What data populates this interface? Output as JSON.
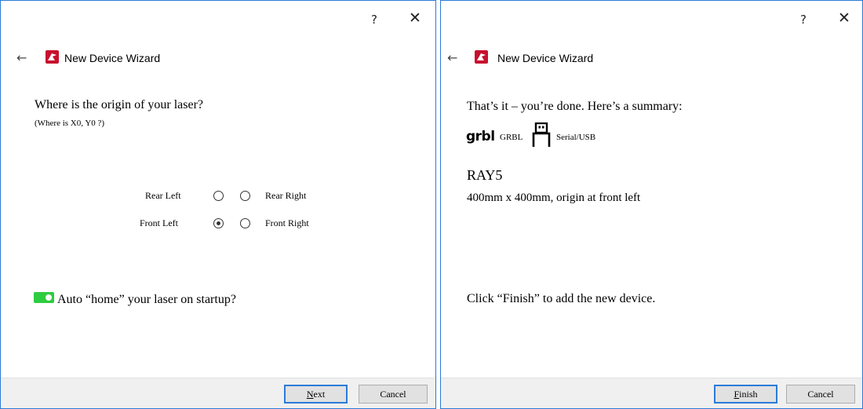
{
  "left": {
    "help_glyph": "?",
    "close_glyph": "✕",
    "back_glyph": "←",
    "title": "New Device Wizard",
    "question": "Where is the origin of your laser?",
    "subquestion": "(Where is X0, Y0 ?)",
    "rear_left": "Rear Left",
    "rear_right": "Rear Right",
    "front_left": "Front Left",
    "front_right": "Front Right",
    "selected_origin": "Front Left",
    "auto_home_label": "Auto “home” your laser on startup?",
    "auto_home_enabled": true,
    "next_mnemonic": "N",
    "next_rest": "ext",
    "cancel": "Cancel"
  },
  "right": {
    "help_glyph": "?",
    "close_glyph": "✕",
    "back_glyph": "←",
    "title": "New Device Wizard",
    "done_text": "That’s it – you’re done.  Here’s a summary:",
    "grbl_logo": "grbl",
    "controller": "GRBL",
    "connection": "Serial/USB",
    "device_name": "RAY5",
    "device_summary": "400mm x 400mm, origin at front left",
    "finish_hint": "Click “Finish” to add the new device.",
    "finish_mnemonic": "F",
    "finish_rest": "inish",
    "cancel": "Cancel"
  },
  "colors": {
    "window_border": "#2b7bd8",
    "toggle_on": "#2ecc40",
    "footer_bg": "#f0f0f0",
    "app_icon": "#c8102e"
  },
  "icons": [
    "help-icon",
    "close-icon",
    "back-arrow-icon",
    "lightburn-app-icon",
    "grbl-logo-icon",
    "usb-icon",
    "toggle-switch"
  ]
}
